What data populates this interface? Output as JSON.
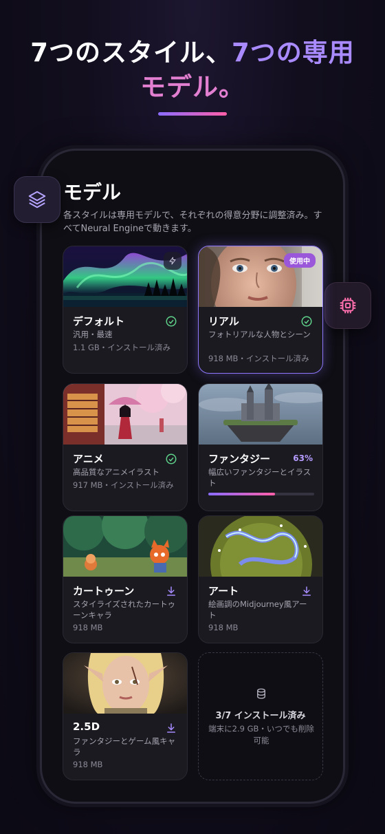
{
  "headline": {
    "line1_white": "7つのスタイル、",
    "line1_accent": "7つの専用",
    "line2": "モデル。"
  },
  "screen": {
    "title": "モデル",
    "subtitle": "各スタイルは専用モデルで、それぞれの得意分野に調整済み。すべてNeural Engineで動きます。"
  },
  "icons": {
    "left_badge": "layers-icon",
    "right_badge": "chip-icon",
    "installed": "check-circle-icon",
    "download": "download-icon",
    "fast": "bolt-icon",
    "storage": "database-icon"
  },
  "colors": {
    "accent_purple": "#8e78ff",
    "accent_pink": "#ff5fa8",
    "installed_green": "#5fd38a",
    "in_use_badge": "#9b57d9"
  },
  "models": [
    {
      "name": "デフォルト",
      "desc": "汎用・最速",
      "size": "1.1 GB・インストール済み",
      "status": "installed"
    },
    {
      "name": "リアル",
      "desc": "フォトリアルな人物とシーン",
      "size": "918 MB・インストール済み",
      "status": "installed",
      "badge": "使用中"
    },
    {
      "name": "アニメ",
      "desc": "高品質なアニメイラスト",
      "size": "917 MB・インストール済み",
      "status": "installed"
    },
    {
      "name": "ファンタジー",
      "desc": "幅広いファンタジーとイラスト",
      "status": "downloading",
      "progress_label": "63%",
      "progress": 0.63
    },
    {
      "name": "カートゥーン",
      "desc": "スタイライズされたカートゥーンキャラ",
      "size": "918 MB",
      "status": "download"
    },
    {
      "name": "アート",
      "desc": "絵画調のMidjourney風アート",
      "size": "918 MB",
      "status": "download"
    },
    {
      "name": "2.5D",
      "desc": "ファンタジーとゲーム風キャラ",
      "size": "918 MB",
      "status": "download"
    }
  ],
  "summary": {
    "title": "3/7 インストール済み",
    "subtitle": "端末に2.9 GB・いつでも削除可能"
  }
}
